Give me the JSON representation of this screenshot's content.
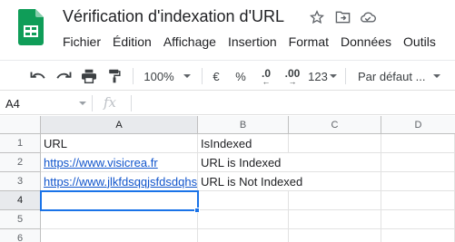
{
  "document": {
    "title": "Vérification d'indexation d'URL",
    "title_icons": [
      "star-icon",
      "move-to-folder-icon",
      "cloud-status-icon"
    ]
  },
  "menu": [
    "Fichier",
    "Édition",
    "Affichage",
    "Insertion",
    "Format",
    "Données",
    "Outils"
  ],
  "toolbar": {
    "undo_icon": "undo-icon",
    "redo_icon": "redo-icon",
    "print_icon": "print-icon",
    "paint_format_icon": "paint-format-icon",
    "zoom": "100%",
    "currency": "€",
    "percent": "%",
    "decrease_decimals": ".0",
    "increase_decimals": ".00",
    "more_formats": "123",
    "font": "Par défaut ..."
  },
  "formula_bar": {
    "name_box": "A4",
    "fx": "fx",
    "content": ""
  },
  "grid": {
    "columns": [
      "A",
      "B",
      "C",
      "D"
    ],
    "rows": [
      "1",
      "2",
      "3",
      "4",
      "5",
      "6"
    ],
    "selected_column": "A",
    "selected_row": "4",
    "cells": {
      "A1": "URL",
      "B1": "IsIndexed",
      "A2": "https://www.visicrea.fr",
      "B2": "URL is Indexed",
      "A3": "https://www.jlkfdsqqjsfdsdqhs",
      "B3": "URL is Not Indexed"
    }
  },
  "colors": {
    "accent": "#1a73e8",
    "link": "#1155cc",
    "sheets_green": "#0f9d58"
  }
}
